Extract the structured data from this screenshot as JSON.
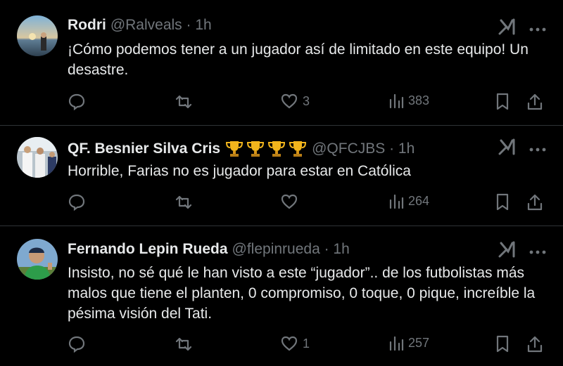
{
  "tweets": [
    {
      "name": "Rodri",
      "handle": "@Ralveals · 1h",
      "text": "¡Cómo podemos tener a un jugador así de limitado en este equipo! Un desastre.",
      "likes": "3",
      "views": "383"
    },
    {
      "name": "QF. Besnier Silva Cris",
      "badges": [
        "trophy-emoji",
        "trophy-emoji",
        "trophy-emoji",
        "trophy-emoji"
      ],
      "handle": "@QFCJBS · 1h",
      "text": "Horrible, Farias no es jugador para estar en Católica",
      "likes": "",
      "views": "264"
    },
    {
      "name": "Fernando Lepin Rueda",
      "handle": "@flepinrueda · 1h",
      "text": "Insisto, no sé qué le han visto a este “jugador”.. de los futbolistas más malos que tiene el planten, 0 compromiso, 0 toque, 0 pique, increíble la pésima visión del Tati.",
      "likes": "1",
      "views": "257"
    }
  ],
  "colors": {
    "background": "#000000",
    "primary_text": "#e7e9ea",
    "secondary_text": "#71767b",
    "divider": "#2f3336"
  },
  "icons": [
    "grok-icon",
    "more-icon",
    "reply-icon",
    "retweet-icon",
    "like-icon",
    "views-icon",
    "bookmark-icon",
    "share-icon"
  ]
}
